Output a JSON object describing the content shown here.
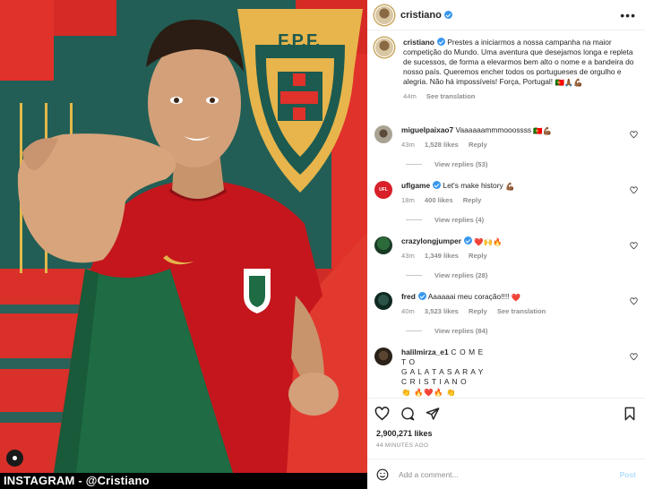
{
  "caption_bar": {
    "text": "INSTAGRAM - @Cristiano"
  },
  "photo": {
    "crest_text": "F.P.F.",
    "colors": {
      "shirt_red": "#c4161c",
      "shirt_green": "#1e6b44",
      "bg_teal": "#225e55",
      "bg_red": "#e0312b",
      "crest_gold": "#e7b54b"
    }
  },
  "header": {
    "username": "cristiano",
    "more_icon": "ellipsis-icon"
  },
  "caption": {
    "username": "cristiano",
    "text": "Prestes a iniciarmos a nossa campanha na maior competição do Mundo. Uma aventura que desejamos longa e repleta de sucessos, de forma a elevarmos bem alto o nome e a bandeira do nosso país. Queremos encher todos os portugueses de orgulho e alegria. Não há impossíveis! Força, Portugal!",
    "emoji": "🇵🇹🙏🏾💪🏾",
    "time": "44m",
    "see_translation": "See translation"
  },
  "comments": [
    {
      "username": "miguelpaixao7",
      "verified": false,
      "text": "Vaaaaaammmooossss",
      "emoji": "🇵🇹💪🏾",
      "time": "43m",
      "likes": "1,528 likes",
      "reply": "Reply",
      "view_replies": "View replies (53)"
    },
    {
      "username": "uflgame",
      "verified": true,
      "text": "Let's make history",
      "emoji": "💪🏾",
      "time": "18m",
      "likes": "400 likes",
      "reply": "Reply",
      "view_replies": "View replies (4)",
      "avatar_text": "UFL"
    },
    {
      "username": "crazylongjumper",
      "verified": true,
      "text": "",
      "emoji": "❤️🙌🔥",
      "time": "43m",
      "likes": "1,349 likes",
      "reply": "Reply",
      "view_replies": "View replies (28)"
    },
    {
      "username": "fred",
      "verified": true,
      "text": "Aaaaaai meu coração!!!!",
      "emoji": "❤️",
      "time": "40m",
      "likes": "3,523 likes",
      "reply": "Reply",
      "see_translation": "See translation",
      "view_replies": "View replies (84)"
    },
    {
      "username": "halilmirza_e1",
      "verified": false,
      "text_lines": [
        "C O M E",
        "T O",
        "G A L A T A S A R A Y",
        "C R I S T I A N O"
      ],
      "emoji": "👏 🔥❤️🔥 👏"
    }
  ],
  "actions": {
    "like_icon": "heart-icon",
    "comment_icon": "comment-icon",
    "share_icon": "share-icon",
    "save_icon": "bookmark-icon",
    "likes": "2,900,271 likes",
    "time_ago": "44 MINUTES AGO"
  },
  "add_comment": {
    "placeholder": "Add a comment...",
    "post_label": "Post",
    "emoji_icon": "smiley-icon"
  }
}
